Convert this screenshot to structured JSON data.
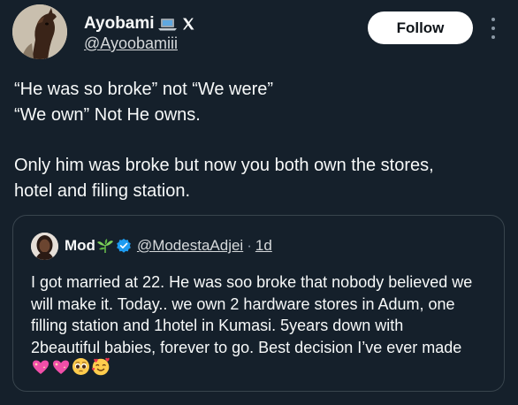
{
  "author": {
    "display_name": "Ayobami",
    "handle": "@Ayoobamiii",
    "icons": [
      "laptop-emoji",
      "x-mark"
    ]
  },
  "follow_label": "Follow",
  "tweet": {
    "lines": [
      "“He was so broke” not “We were”",
      "“We own” Not He owns.",
      "",
      "Only him was broke but now you both own the stores,",
      "hotel and filing station."
    ]
  },
  "quoted_tweet": {
    "display_name": "Mod",
    "handle": "@ModestaAdjei",
    "separator": "·",
    "time": "1d",
    "icons": [
      "plant-emoji",
      "verified-badge"
    ],
    "lines": [
      "I got married at 22. He was soo broke that nobody believed we",
      "will make it. Today.. we own 2 hardware stores in Adum, one",
      "filling station and 1hotel in Kumasi. 5years down with",
      "2beautiful babies, forever to go. Best decision I’ve ever made"
    ],
    "emojis": [
      "sparkling-heart-emoji",
      "sparkling-heart-emoji",
      "pleading-face-emoji",
      "smiling-face-with-hearts-emoji"
    ]
  },
  "colors": {
    "background": "#15202b",
    "text": "#f7f9f9",
    "secondary_text": "#8b98a5",
    "verified": "#1d9bf0",
    "card_border": "#38444d"
  }
}
